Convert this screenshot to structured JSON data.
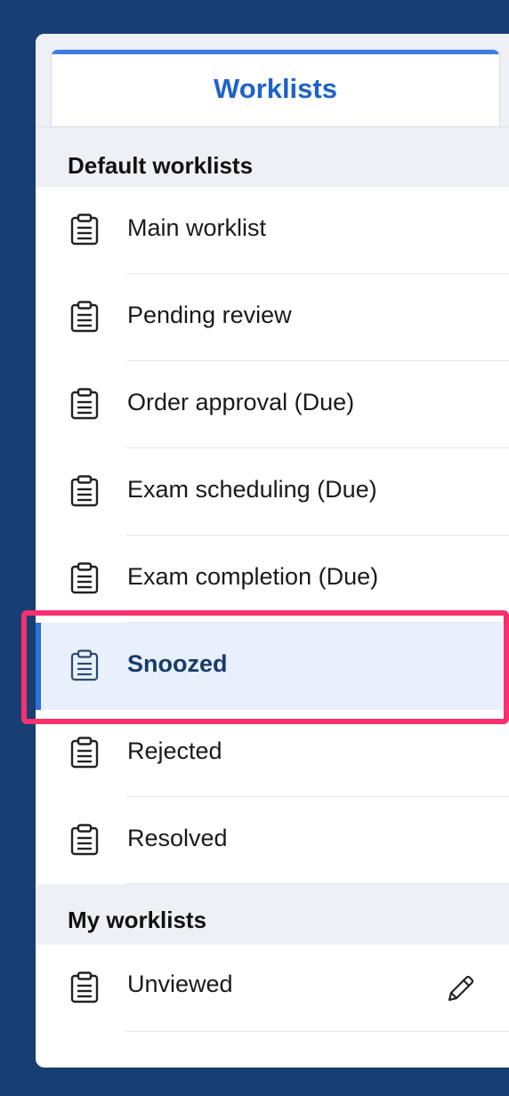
{
  "tab": {
    "label": "Worklists"
  },
  "sections": {
    "default": {
      "title": "Default worklists",
      "items": [
        {
          "label": "Main worklist"
        },
        {
          "label": "Pending review"
        },
        {
          "label": "Order approval (Due)"
        },
        {
          "label": "Exam scheduling (Due)"
        },
        {
          "label": "Exam completion (Due)"
        },
        {
          "label": "Snoozed",
          "selected": true
        },
        {
          "label": "Rejected"
        },
        {
          "label": "Resolved"
        }
      ]
    },
    "mine": {
      "title": "My worklists",
      "items": [
        {
          "label": "Unviewed",
          "editable": true
        }
      ]
    }
  },
  "colors": {
    "background": "#173f73",
    "accent": "#1e62c9",
    "selected_bg": "#e9f0fb",
    "highlight": "#fa2f6e"
  },
  "icons": {
    "list_item": "clipboard-icon",
    "edit": "pencil-icon"
  }
}
